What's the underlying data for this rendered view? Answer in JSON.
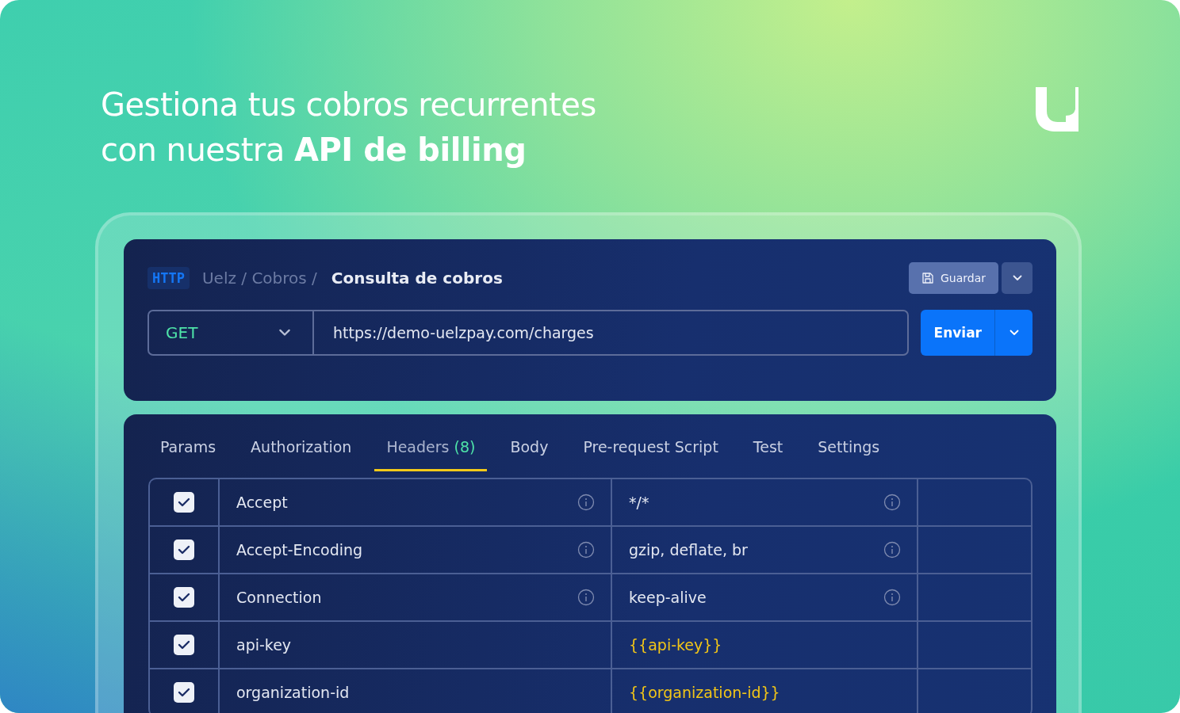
{
  "headline": {
    "lines": [
      "Gestiona tus cobros recurrentes",
      "con nuestra **API de billing**"
    ]
  },
  "request": {
    "protocol": "HTTP",
    "breadcrumb": "Uelz / Cobros /",
    "name": "Consulta de cobros",
    "save_label": "Guardar",
    "method": "GET",
    "url": "https://demo-uelzpay.com/charges",
    "send_label": "Enviar"
  },
  "tabs": [
    {
      "label": "Params",
      "selected": false
    },
    {
      "label": "Authorization",
      "selected": false
    },
    {
      "label": "Headers",
      "count": "(8)",
      "selected": true
    },
    {
      "label": "Body",
      "selected": false
    },
    {
      "label": "Pre-request Script",
      "selected": false
    },
    {
      "label": "Test",
      "selected": false
    },
    {
      "label": "Settings",
      "selected": false
    }
  ],
  "headers": [
    {
      "checked": true,
      "key": "Accept",
      "key_info": true,
      "value": "*/*",
      "kind": "text",
      "value_info": true
    },
    {
      "checked": true,
      "key": "Accept-Encoding",
      "key_info": true,
      "value": "gzip, deflate, br",
      "kind": "text",
      "value_info": true
    },
    {
      "checked": true,
      "key": "Connection",
      "key_info": true,
      "value": "keep-alive",
      "kind": "text",
      "value_info": true
    },
    {
      "checked": true,
      "key": "api-key",
      "key_info": false,
      "value": "{{api-key}}",
      "kind": "variable",
      "value_info": false
    },
    {
      "checked": true,
      "key": "organization-id",
      "key_info": false,
      "value": "{{organization-id}}",
      "kind": "variable",
      "value_info": false
    }
  ]
}
